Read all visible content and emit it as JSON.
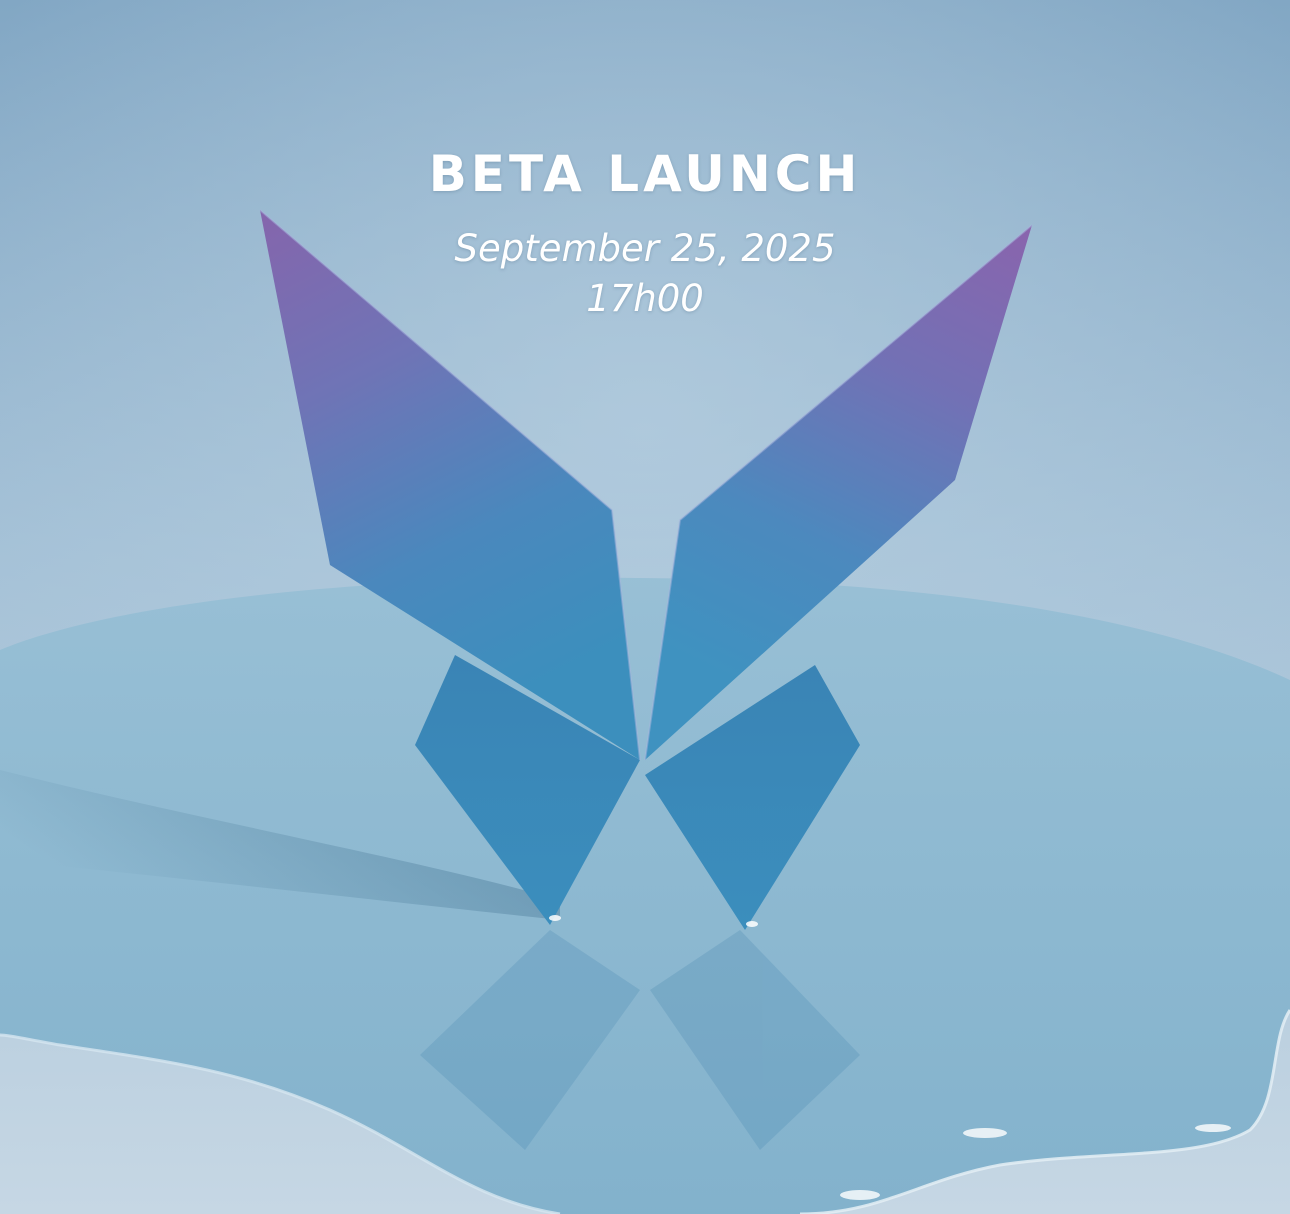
{
  "event": {
    "title": "BETA LAUNCH",
    "date": "September 25, 2025",
    "time": "17h00"
  },
  "colors": {
    "background_top": "#86aac5",
    "background_bottom": "#c4d5e3",
    "puddle": "#86b6cf",
    "wing_top": "#7e68b0",
    "wing_bottom": "#3f8fbd",
    "text": "#ffffff"
  },
  "image": {
    "subject": "origami-butterfly"
  }
}
